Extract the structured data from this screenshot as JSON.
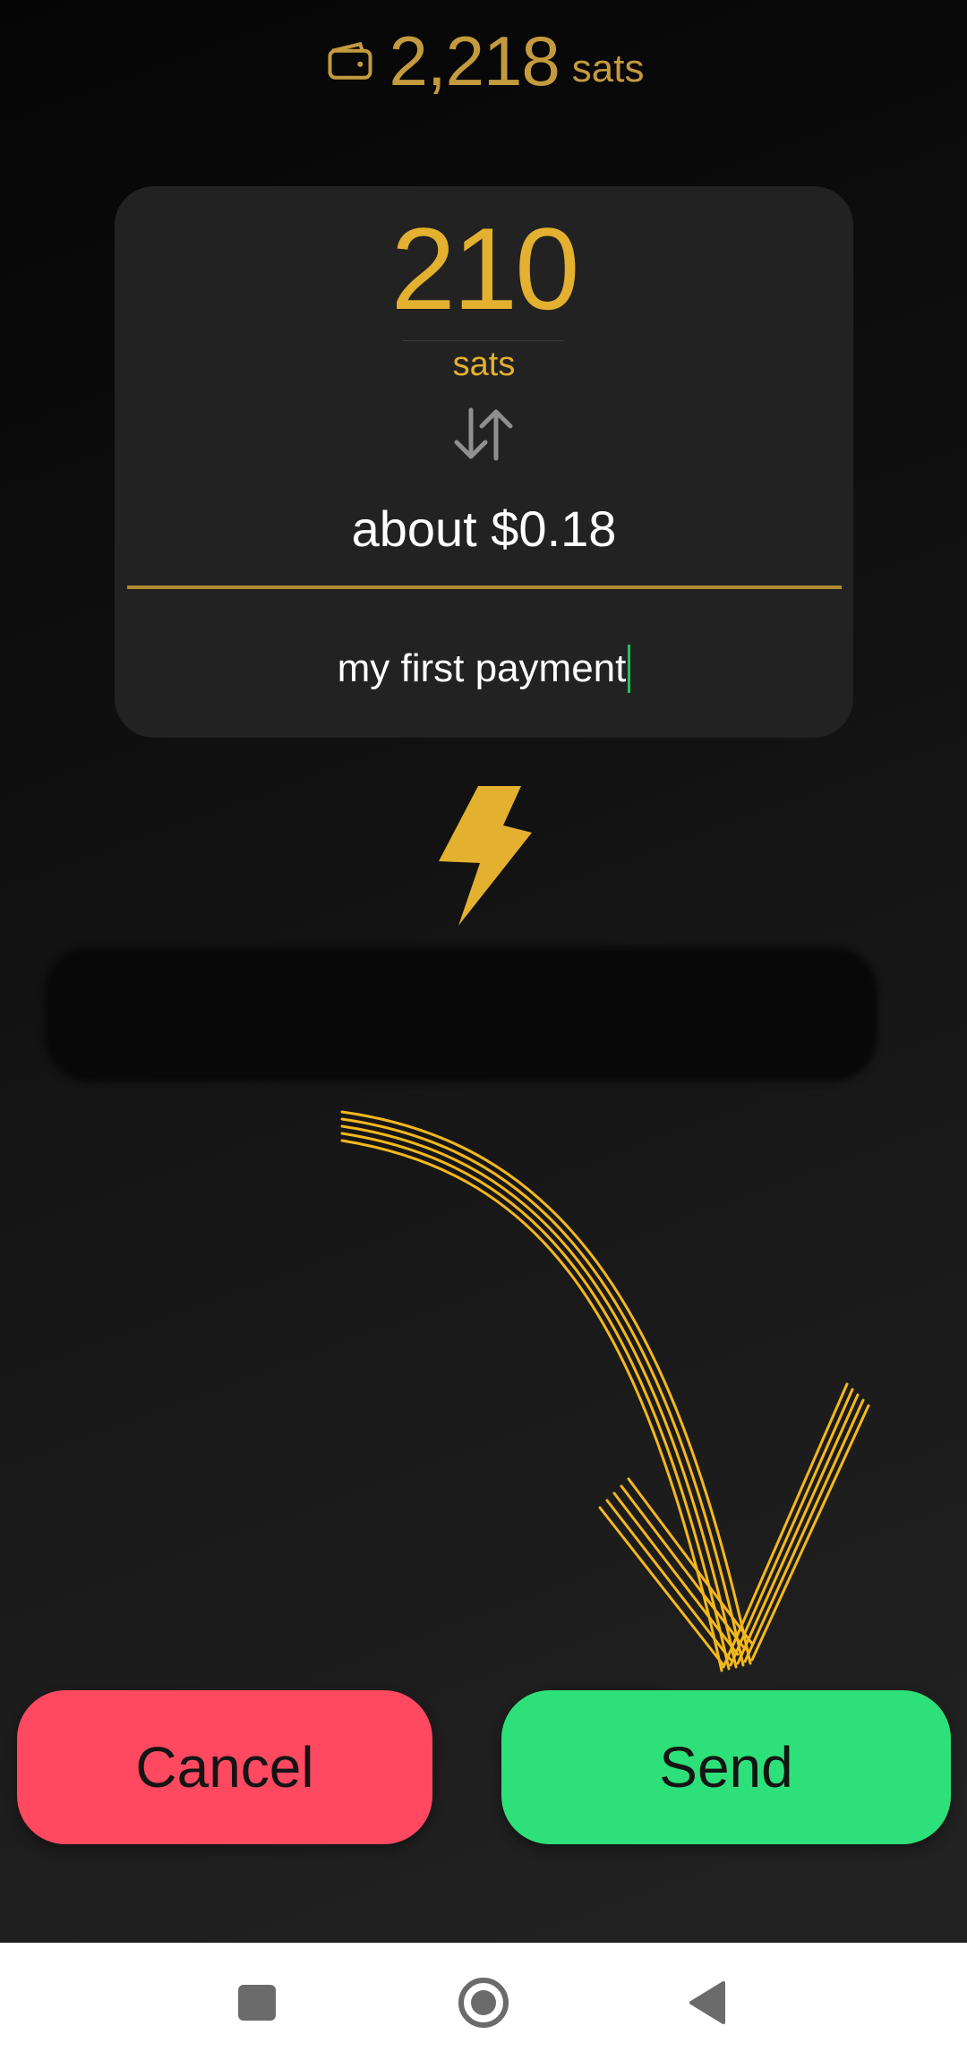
{
  "header": {
    "wallet_icon": "wallet-icon",
    "balance": "2,218",
    "balance_unit": "sats"
  },
  "amount_card": {
    "amount": "210",
    "unit": "sats",
    "swap_icon": "swap-vertical-icon",
    "fiat_value": "about $0.18",
    "memo": "my first payment"
  },
  "lightning_icon": "lightning-bolt-icon",
  "actions": {
    "cancel_label": "Cancel",
    "send_label": "Send"
  },
  "nav": {
    "recents_icon": "square-icon",
    "home_icon": "home-circle-icon",
    "back_icon": "back-triangle-icon"
  },
  "colors": {
    "accent_gold": "#e3b02f",
    "cancel_red": "#ff4961",
    "send_green": "#2ee07a",
    "card_bg": "#222222"
  }
}
